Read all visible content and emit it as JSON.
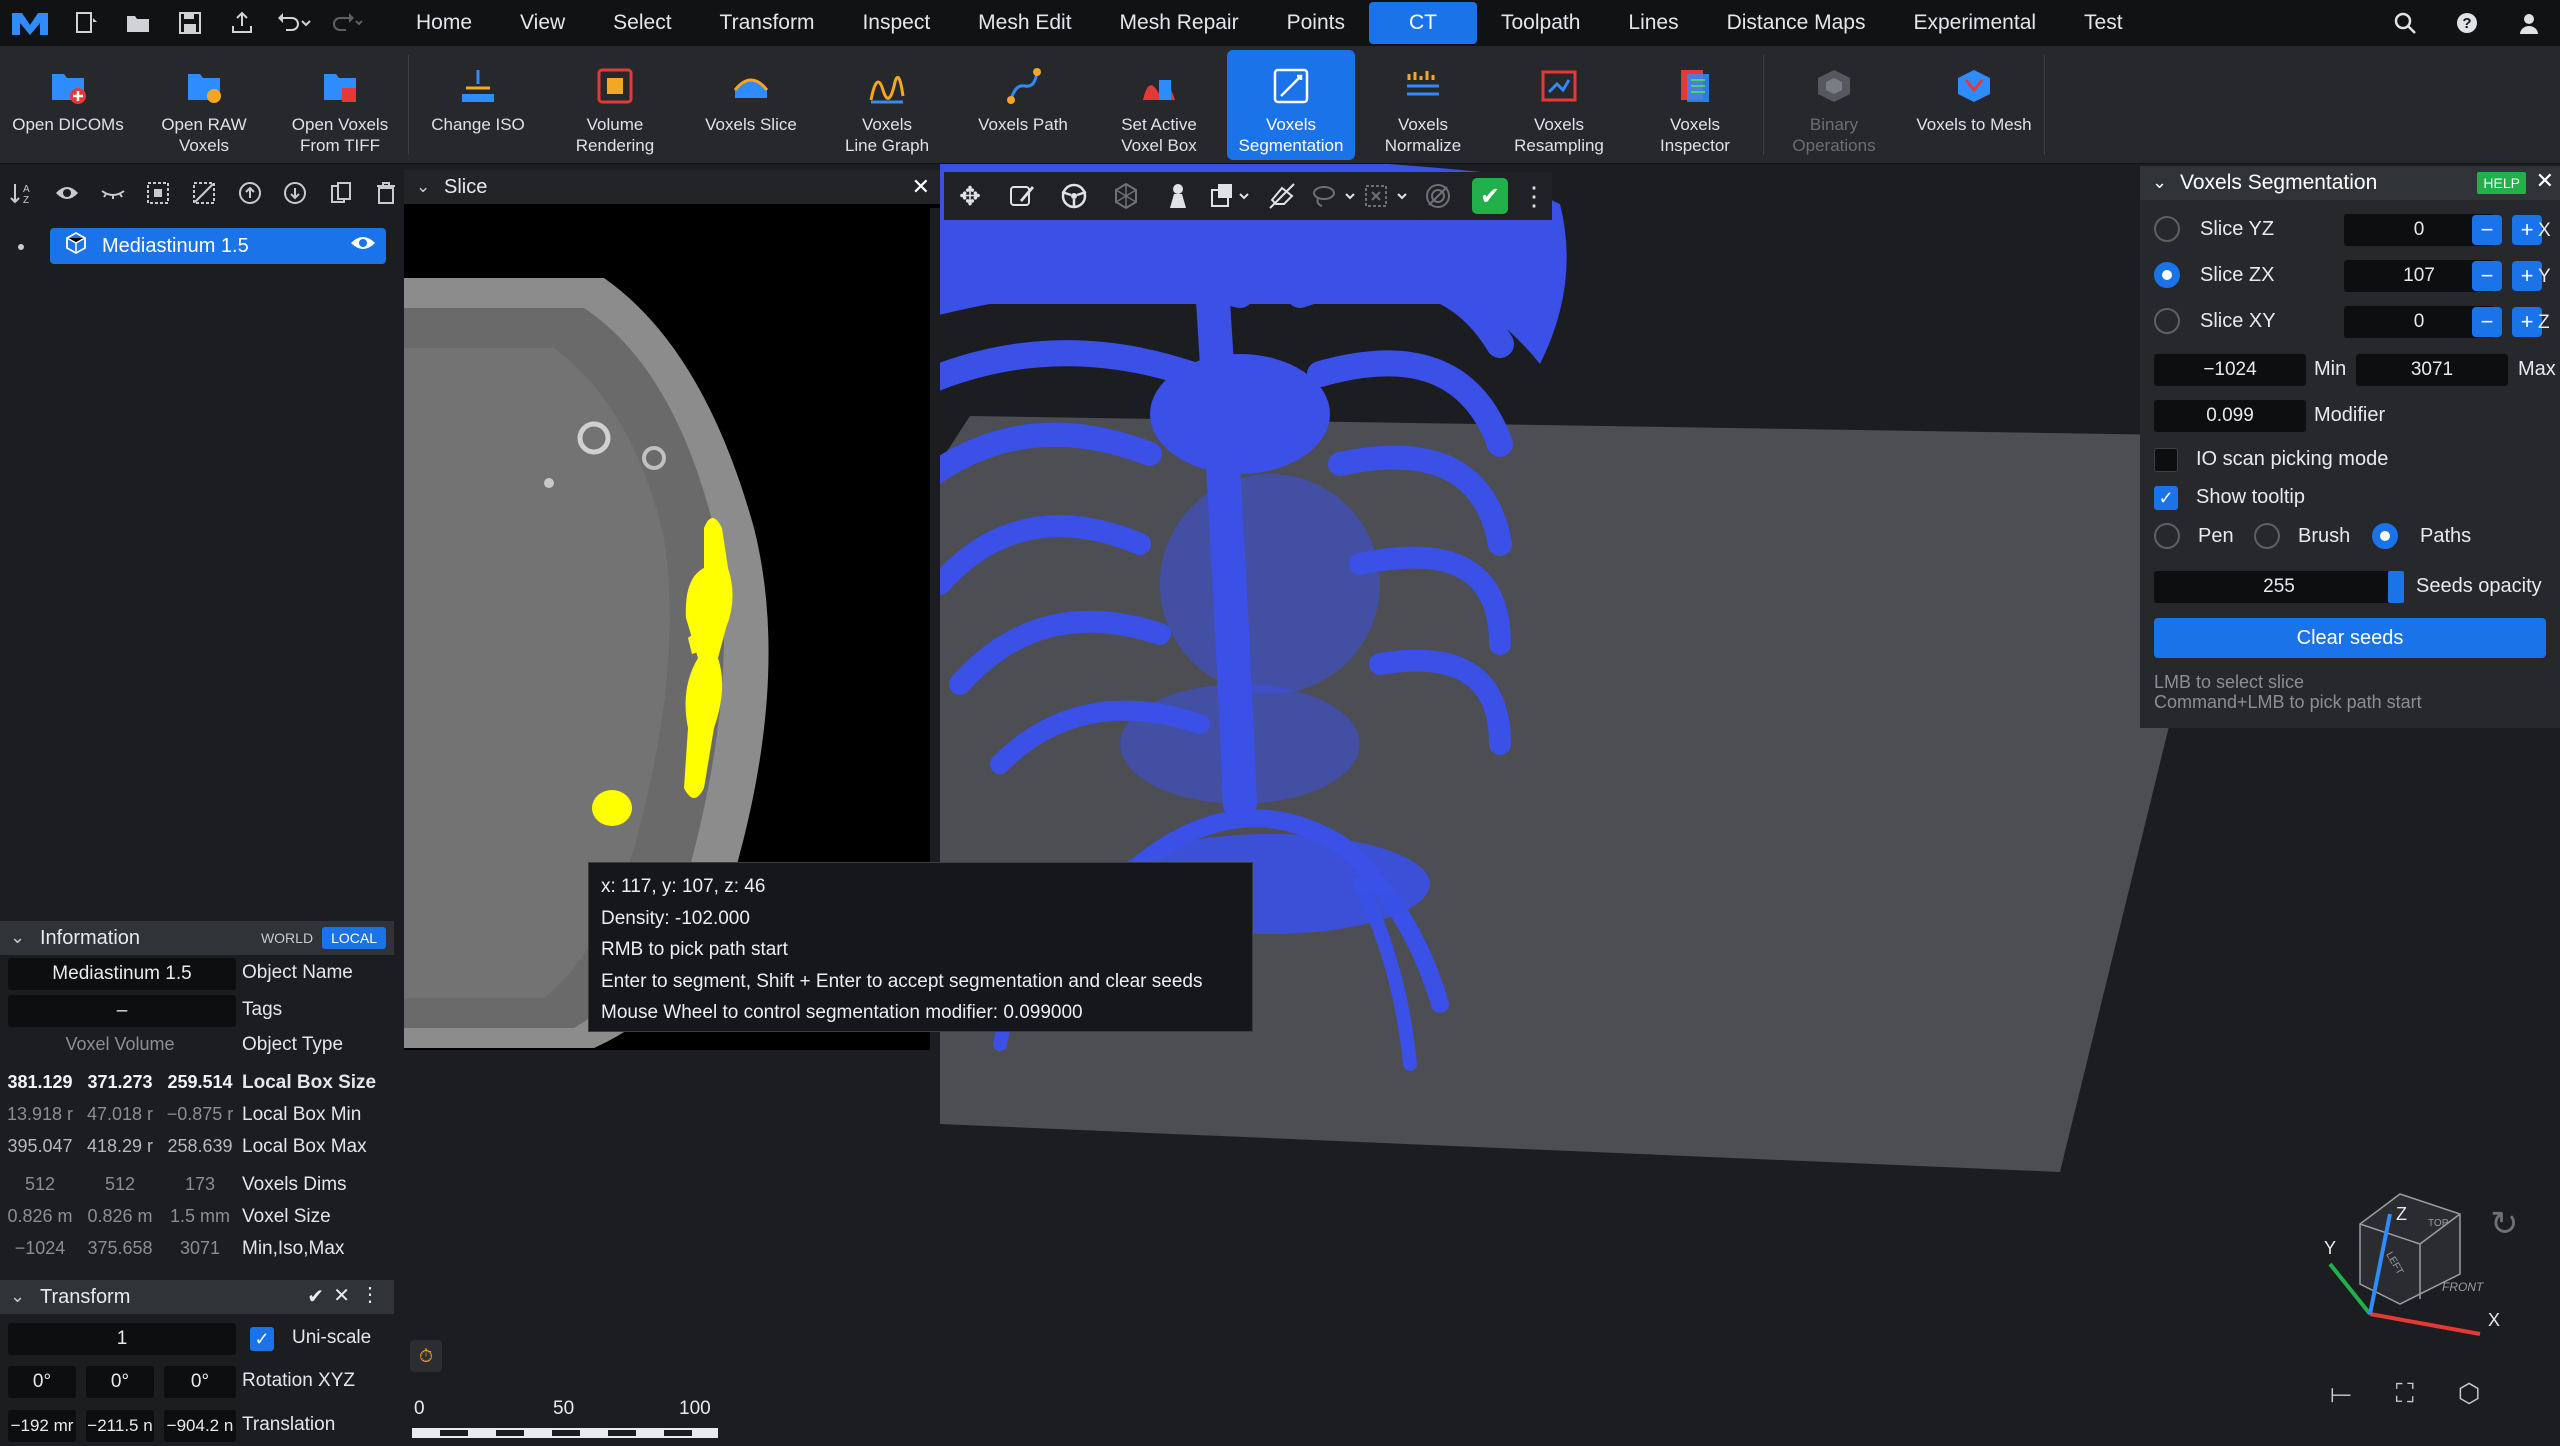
{
  "menubar": {
    "items": [
      "Home",
      "View",
      "Select",
      "Transform",
      "Inspect",
      "Mesh Edit",
      "Mesh Repair",
      "Points",
      "CT",
      "Toolpath",
      "Lines",
      "Distance Maps",
      "Experimental",
      "Test"
    ],
    "active": "CT"
  },
  "ribbon": {
    "buttons": [
      {
        "label": "Open DICOMs",
        "icon": "open-dicoms-icon"
      },
      {
        "label": "Open RAW\nVoxels",
        "icon": "open-raw-icon"
      },
      {
        "label": "Open Voxels\nFrom TIFF",
        "icon": "open-tiff-icon"
      },
      {
        "label": "Change ISO",
        "icon": "change-iso-icon"
      },
      {
        "label": "Volume\nRendering",
        "icon": "volume-rendering-icon"
      },
      {
        "label": "Voxels Slice",
        "icon": "voxels-slice-icon"
      },
      {
        "label": "Voxels\nLine Graph",
        "icon": "line-graph-icon"
      },
      {
        "label": "Voxels Path",
        "icon": "voxels-path-icon"
      },
      {
        "label": "Set Active\nVoxel Box",
        "icon": "voxel-box-icon"
      },
      {
        "label": "Voxels\nSegmentation",
        "icon": "segmentation-icon"
      },
      {
        "label": "Voxels\nNormalize",
        "icon": "normalize-icon"
      },
      {
        "label": "Voxels\nResampling",
        "icon": "resampling-icon"
      },
      {
        "label": "Voxels\nInspector",
        "icon": "inspector-icon"
      },
      {
        "label": "Binary\nOperations",
        "icon": "binary-operations-icon"
      },
      {
        "label": "Voxels to Mesh",
        "icon": "voxels-to-mesh-icon"
      }
    ]
  },
  "scene": {
    "object_name": "Mediastinum 1.5"
  },
  "information": {
    "title": "Information",
    "world": "WORLD",
    "local": "LOCAL",
    "object_name_value": "Mediastinum 1.5",
    "object_name_label": "Object Name",
    "tags_value": "–",
    "tags_label": "Tags",
    "object_type_value": "Voxel Volume",
    "object_type_label": "Object Type",
    "local_box_size": [
      "381.129",
      "371.273",
      "259.514"
    ],
    "local_box_size_label": "Local Box Size",
    "local_box_min": [
      "13.918 r",
      "47.018 r",
      "−0.875 r"
    ],
    "local_box_min_label": "Local Box Min",
    "local_box_max": [
      "395.047",
      "418.29 r",
      "258.639"
    ],
    "local_box_max_label": "Local Box Max",
    "voxels_dims": [
      "512",
      "512",
      "173"
    ],
    "voxels_dims_label": "Voxels Dims",
    "voxel_size": [
      "0.826 m",
      "0.826 m",
      "1.5 mm"
    ],
    "voxel_size_label": "Voxel Size",
    "min_iso_max": [
      "−1024",
      "375.658",
      "3071"
    ],
    "min_iso_max_label": "Min,Iso,Max"
  },
  "transform": {
    "title": "Transform",
    "scale_value": "1",
    "uniscale_label": "Uni-scale",
    "rotation": [
      "0°",
      "0°",
      "0°"
    ],
    "rotation_label": "Rotation XYZ",
    "translation": [
      "−192 mr",
      "−211.5 n",
      "−904.2 n"
    ],
    "translation_label": "Translation"
  },
  "slice_panel": {
    "title": "Slice"
  },
  "tooltip": {
    "lines": [
      "x: 117, y: 107, z: 46",
      "Density: -102.000",
      "RMB to pick path start",
      "Enter to segment, Shift + Enter to accept segmentation and clear seeds",
      "Mouse Wheel to control segmentation modifier: 0.099000"
    ]
  },
  "tool_panel": {
    "title": "Voxels Segmentation",
    "help": "HELP",
    "slices": [
      {
        "label": "Slice YZ",
        "value": "0",
        "axis": "X",
        "selected": false
      },
      {
        "label": "Slice ZX",
        "value": "107",
        "axis": "Y",
        "selected": true
      },
      {
        "label": "Slice XY",
        "value": "0",
        "axis": "Z",
        "selected": false
      }
    ],
    "min_value": "−1024",
    "min_label": "Min",
    "max_value": "3071",
    "max_label": "Max",
    "modifier_value": "0.099",
    "modifier_label": "Modifier",
    "io_scan_label": "IO scan picking mode",
    "io_scan_checked": false,
    "show_tooltip_label": "Show tooltip",
    "show_tooltip_checked": true,
    "modes": [
      "Pen",
      "Brush",
      "Paths"
    ],
    "mode_selected": "Paths",
    "seeds_opacity_value": "255",
    "seeds_opacity_label": "Seeds opacity",
    "clear_seeds": "Clear seeds",
    "hint1": "LMB to select slice",
    "hint2": "Command+LMB to pick path start"
  },
  "ruler": {
    "labels": [
      "0",
      "50",
      "100"
    ]
  },
  "axes_cube": {
    "top": "TOP",
    "front": "FRONT",
    "left": "LEFT",
    "x": "X",
    "y": "Y",
    "z": "Z"
  },
  "colors": {
    "accent": "#1a73e8",
    "segmentation_blue": "#3a50e6",
    "seed_yellow": "#ffff00",
    "confirm_green": "#21b04a"
  }
}
